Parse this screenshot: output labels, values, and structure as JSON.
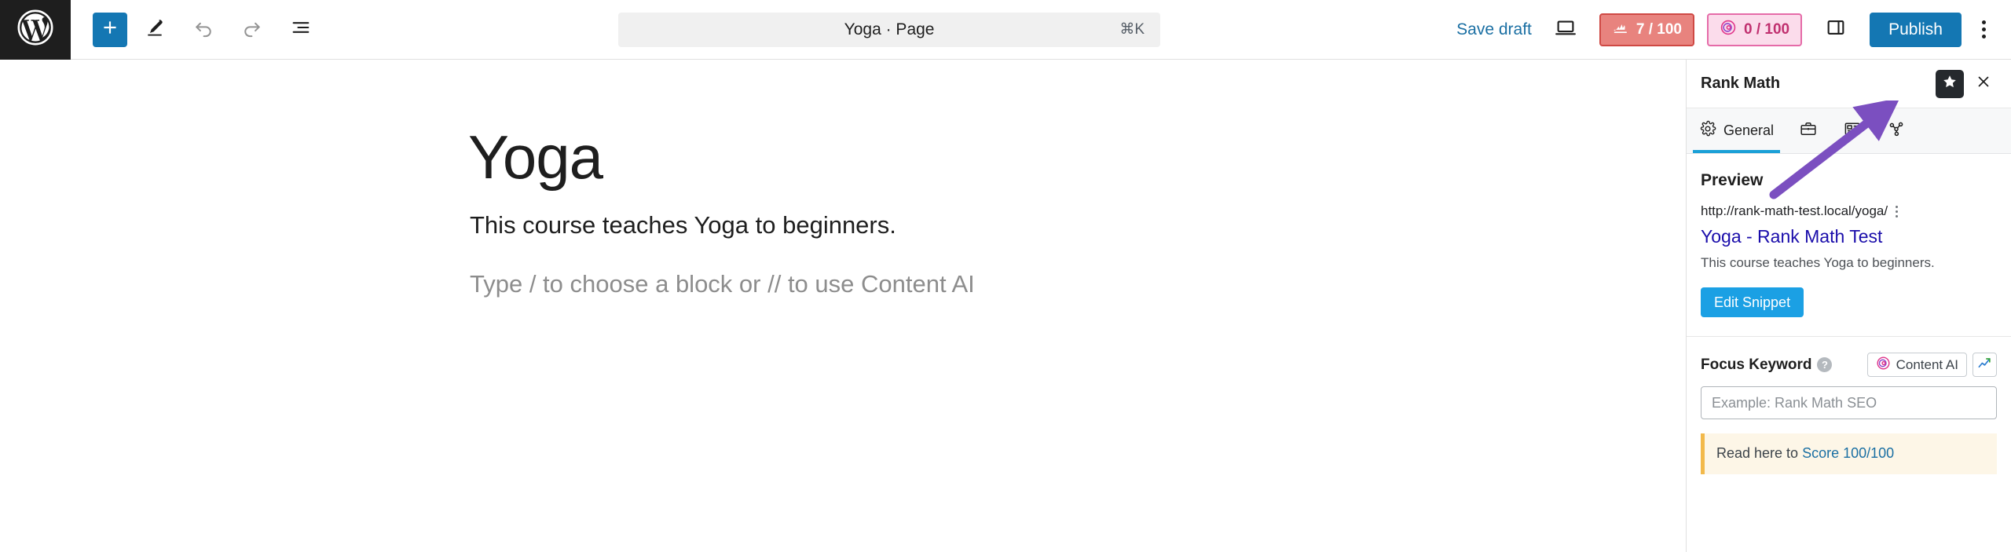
{
  "toolbar": {
    "logo_icon": "wordpress-logo-icon",
    "add_block_label": "+",
    "add_block_icon": "plus-icon",
    "edit_icon": "pencil-icon",
    "undo_icon": "undo-icon",
    "redo_icon": "redo-icon",
    "list_view_icon": "document-overview-icon",
    "command_title": "Yoga · Page",
    "command_shortcut": "⌘K",
    "save_draft_label": "Save draft",
    "preview_icon": "laptop-preview-icon",
    "seo_score": "7 / 100",
    "seo_score_icon": "rank-math-icon",
    "content_ai_score": "0 / 100",
    "content_ai_icon": "content-ai-icon",
    "settings_sidebar_icon": "settings-sidebar-icon",
    "publish_label": "Publish",
    "options_icon": "more-options-icon"
  },
  "editor": {
    "title": "Yoga",
    "paragraph": "This course teaches Yoga to beginners.",
    "placeholder": "Type / to choose a block or // to use Content AI"
  },
  "rank_math": {
    "panel_title": "Rank Math",
    "star_icon": "star-icon",
    "close_icon": "close-icon",
    "tabs": [
      {
        "label": "General",
        "icon": "gear-icon",
        "active": true
      },
      {
        "label": "",
        "icon": "briefcase-icon",
        "active": false
      },
      {
        "label": "",
        "icon": "schema-snippet-icon",
        "active": false
      },
      {
        "label": "",
        "icon": "social-share-icon",
        "active": false
      }
    ],
    "preview_heading": "Preview",
    "snippet": {
      "url": "http://rank-math-test.local/yoga/",
      "menu_icon": "snippet-menu-icon",
      "title": "Yoga - Rank Math Test",
      "description": "This course teaches Yoga to beginners."
    },
    "edit_snippet_label": "Edit Snippet",
    "focus_keyword": {
      "label": "Focus Keyword",
      "help_icon": "help-icon",
      "content_ai_label": "Content AI",
      "content_ai_icon": "content-ai-icon",
      "trends_icon": "trend-chart-icon",
      "input_value": "",
      "input_placeholder": "Example: Rank Math SEO"
    },
    "notice": {
      "text_prefix": "Read here to ",
      "link_text": "Score 100/100"
    }
  },
  "annotation": {
    "arrow_icon": "purple-arrow-icon",
    "arrow_color": "#7b4fc0"
  },
  "colors": {
    "wp_blue": "#1477b3",
    "snippet_blue": "#1ba0e4",
    "seo_badge_bg": "#e8837e",
    "seo_badge_border": "#cf4944",
    "ai_badge_bg": "#fbdceb",
    "ai_badge_border": "#e56ba8",
    "tab_active": "#1ba0d7",
    "notice_bg": "#fdf6e7",
    "notice_border": "#f2b94b"
  }
}
